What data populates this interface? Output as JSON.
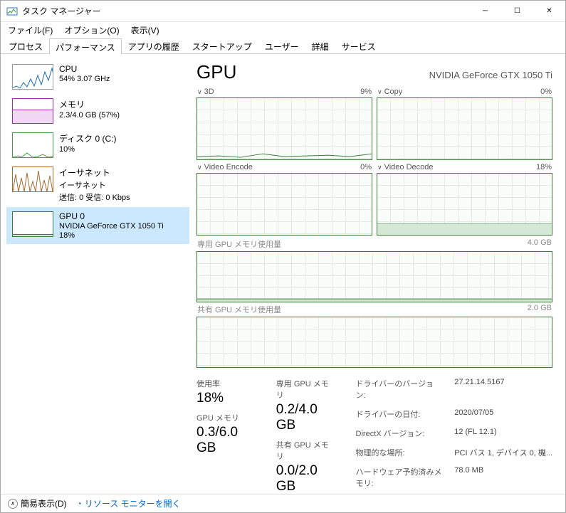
{
  "window": {
    "title": "タスク マネージャー"
  },
  "menu": {
    "file": "ファイル(F)",
    "options": "オプション(O)",
    "view": "表示(V)"
  },
  "tabs": {
    "processes": "プロセス",
    "performance": "パフォーマンス",
    "history": "アプリの履歴",
    "startup": "スタートアップ",
    "users": "ユーザー",
    "details": "詳細",
    "services": "サービス"
  },
  "sidebar": {
    "cpu": {
      "name": "CPU",
      "detail": "54%  3.07 GHz"
    },
    "memory": {
      "name": "メモリ",
      "detail": "2.3/4.0 GB (57%)"
    },
    "disk": {
      "name": "ディスク 0 (C:)",
      "detail": "10%"
    },
    "ethernet": {
      "name": "イーサネット",
      "detail1": "イーサネット",
      "detail2": "送信: 0 受信: 0 Kbps"
    },
    "gpu": {
      "name": "GPU 0",
      "detail1": "NVIDIA GeForce GTX 1050 Ti",
      "detail2": "18%"
    }
  },
  "main": {
    "title": "GPU",
    "subtitle": "NVIDIA GeForce GTX 1050 Ti",
    "charts": {
      "g3d": {
        "label": "3D",
        "value": "9%"
      },
      "copy": {
        "label": "Copy",
        "value": "0%"
      },
      "encode": {
        "label": "Video Encode",
        "value": "0%"
      },
      "decode": {
        "label": "Video Decode",
        "value": "18%"
      },
      "dedicated": {
        "label": "専用 GPU メモリ使用量",
        "max": "4.0 GB"
      },
      "shared": {
        "label": "共有 GPU メモリ使用量",
        "max": "2.0 GB"
      }
    },
    "stats": {
      "usage": {
        "label": "使用率",
        "value": "18%"
      },
      "dedicated": {
        "label": "専用 GPU メモリ",
        "value": "0.2/4.0 GB"
      },
      "gpumem": {
        "label": "GPU メモリ",
        "value": "0.3/6.0 GB"
      },
      "shared": {
        "label": "共有 GPU メモリ",
        "value": "0.0/2.0 GB"
      }
    },
    "info": {
      "driver_ver_l": "ドライバーのバージョン:",
      "driver_ver_v": "27.21.14.5167",
      "driver_date_l": "ドライバーの日付:",
      "driver_date_v": "2020/07/05",
      "directx_l": "DirectX バージョン:",
      "directx_v": "12 (FL 12.1)",
      "location_l": "物理的な場所:",
      "location_v": "PCI バス 1, デバイス 0, 機...",
      "reserved_l": "ハードウェア予約済みメモリ:",
      "reserved_v": "78.0 MB"
    }
  },
  "statusbar": {
    "collapse": "簡易表示(D)",
    "resmon": "リソース モニターを開く"
  },
  "colors": {
    "cpu": "#1a6cb8",
    "memory": "#9b2fa6",
    "disk": "#4a9c4a",
    "ethernet": "#a66a2e",
    "gpu": "#3c7a3c"
  },
  "chart_data": [
    {
      "type": "line",
      "title": "3D",
      "ylim": [
        0,
        100
      ],
      "note": "current ~9%, mostly low with small bumps"
    },
    {
      "type": "line",
      "title": "Copy",
      "ylim": [
        0,
        100
      ],
      "note": "flat 0%"
    },
    {
      "type": "line",
      "title": "Video Encode",
      "ylim": [
        0,
        100
      ],
      "note": "flat 0%"
    },
    {
      "type": "line",
      "title": "Video Decode",
      "ylim": [
        0,
        100
      ],
      "note": "flat line roughly 18%"
    },
    {
      "type": "area",
      "title": "専用 GPU メモリ使用量",
      "ylim": [
        0,
        4.0
      ],
      "unit": "GB",
      "note": "flat low ~0.2 GB"
    },
    {
      "type": "area",
      "title": "共有 GPU メモリ使用量",
      "ylim": [
        0,
        2.0
      ],
      "unit": "GB",
      "note": "flat ~0 GB"
    }
  ]
}
